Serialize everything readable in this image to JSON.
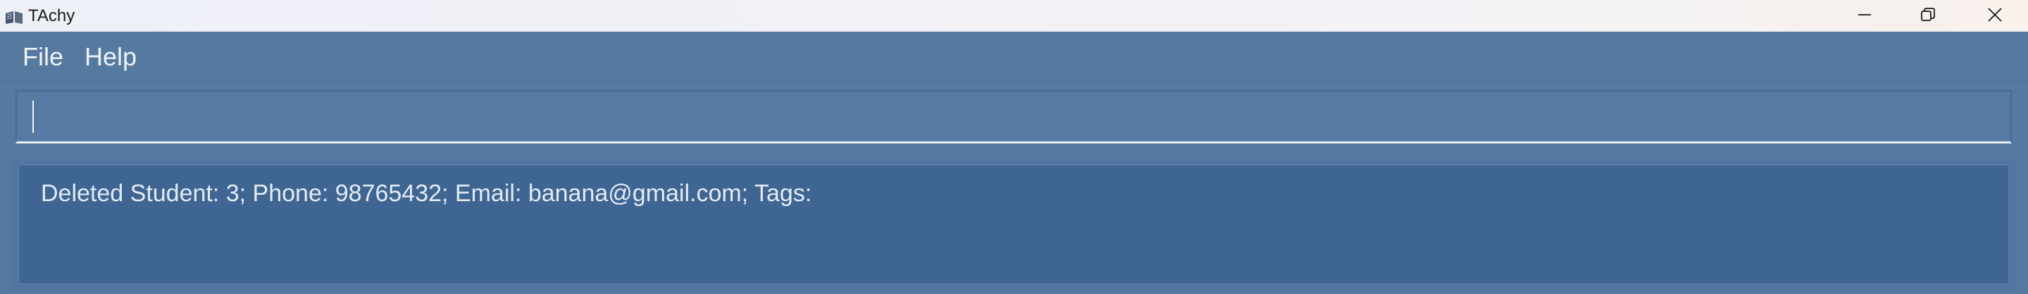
{
  "window": {
    "title": "TAchy",
    "controls": {
      "minimize": "minimize-icon",
      "maximize": "restore-icon",
      "close": "close-icon"
    }
  },
  "menu": {
    "items": [
      {
        "label": "File"
      },
      {
        "label": "Help"
      }
    ]
  },
  "command": {
    "value": "",
    "placeholder": ""
  },
  "result": {
    "text": "Deleted Student: 3; Phone: 98765432; Email: banana@gmail.com; Tags:"
  },
  "colors": {
    "background": "#5479a3",
    "result_box": "#3f6593",
    "text": "#e4ebf3"
  }
}
